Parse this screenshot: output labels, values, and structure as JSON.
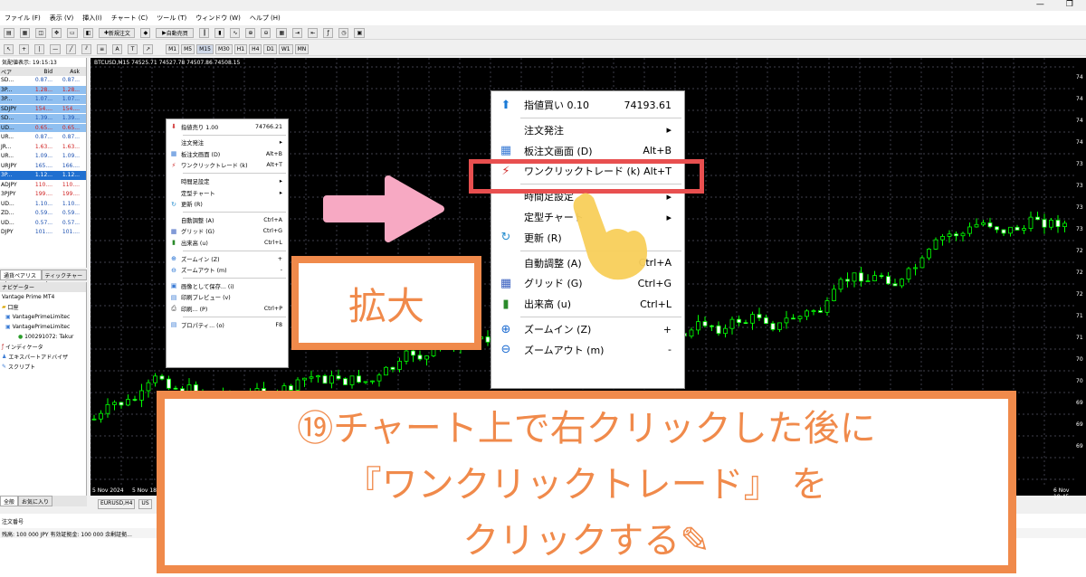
{
  "menubar": {
    "items": [
      "ファイル (F)",
      "表示 (V)",
      "挿入(I)",
      "チャート (C)",
      "ツール (T)",
      "ウィンドウ (W)",
      "ヘルプ (H)"
    ]
  },
  "window_controls": {
    "minimize": "—",
    "restore": "❐"
  },
  "toolbar": {
    "new_order": "新規注文",
    "auto_trade": "自動売買",
    "timeframes": [
      "M1",
      "M5",
      "M15",
      "M30",
      "H1",
      "H4",
      "D1",
      "W1",
      "MN"
    ]
  },
  "market_watch": {
    "title": "気配値表示: 19:15:13",
    "columns": [
      "ペア",
      "Bid",
      "Ask"
    ],
    "rows": [
      [
        "SD...",
        "0.87...",
        "0.87..."
      ],
      [
        "3P...",
        "1.28...",
        "1.28..."
      ],
      [
        "3P...",
        "1.07...",
        "1.07..."
      ],
      [
        "SDJPY",
        "154....",
        "154...."
      ],
      [
        "SD...",
        "1.39...",
        "1.39..."
      ],
      [
        "UD...",
        "0.65...",
        "0.65..."
      ],
      [
        "UR...",
        "0.87...",
        "0.87..."
      ],
      [
        "JR...",
        "1.63...",
        "1.63..."
      ],
      [
        "UR...",
        "1.09...",
        "1.09..."
      ],
      [
        "URJPY",
        "165....",
        "166...."
      ],
      [
        "3P...",
        "1.12...",
        "1.12..."
      ],
      [
        "ADJPY",
        "110....",
        "110...."
      ],
      [
        "3PJPY",
        "199....",
        "199...."
      ],
      [
        "UD...",
        "1.10...",
        "1.10..."
      ],
      [
        "ZD...",
        "0.59...",
        "0.59..."
      ],
      [
        "UD...",
        "0.57...",
        "0.57..."
      ],
      [
        "DJPY",
        "101....",
        "101...."
      ]
    ],
    "tabs": [
      "通貨ペアリスト",
      "ティックチャート"
    ]
  },
  "navigator": {
    "title": "ナビゲーター",
    "items": [
      "Vantage Prime MT4",
      "口座",
      "VantagePrimeLimitec",
      "VantagePrimeLimitec",
      "100291072: Takur",
      "インディケータ",
      "エキスパートアドバイザ",
      "スクリプト"
    ],
    "tabs": [
      "全般",
      "お気に入り"
    ]
  },
  "chart": {
    "title": "BTCUSD,M15  74525.71 74527.78 74507.86 74508.15",
    "x_labels": [
      "5 Nov 2024",
      "5 Nov 18:45",
      "6 Nov 18:45"
    ],
    "tabs": [
      "EURUSD,H4",
      "US"
    ],
    "y_labels": [
      "74",
      "74",
      "74",
      "74",
      "73",
      "73",
      "73",
      "73",
      "72",
      "72",
      "72",
      "71",
      "71",
      "70",
      "70",
      "69",
      "69",
      "69"
    ]
  },
  "terminal": {
    "order_label": "注文番号",
    "status": "残高: 100 000 JPY  有効証拠金: 100 000  余剰証拠..."
  },
  "small_menu": {
    "items": [
      {
        "label": "指値売り 1.00",
        "shortcut": "74766.21"
      },
      {
        "label": "注文発注",
        "shortcut": "▸"
      },
      {
        "label": "板注文画面 (D)",
        "shortcut": "Alt+B"
      },
      {
        "label": "ワンクリックトレード (k)",
        "shortcut": "Alt+T"
      },
      {
        "label": "時間足設定",
        "shortcut": "▸"
      },
      {
        "label": "定型チャート",
        "shortcut": "▸"
      },
      {
        "label": "更新 (R)",
        "shortcut": ""
      },
      {
        "label": "自動調整 (A)",
        "shortcut": "Ctrl+A"
      },
      {
        "label": "グリッド (G)",
        "shortcut": "Ctrl+G"
      },
      {
        "label": "出来高 (u)",
        "shortcut": "Ctrl+L"
      },
      {
        "label": "ズームイン (Z)",
        "shortcut": "+"
      },
      {
        "label": "ズームアウト (m)",
        "shortcut": "-"
      },
      {
        "label": "画像として保存... (i)",
        "shortcut": ""
      },
      {
        "label": "印刷プレビュー (v)",
        "shortcut": ""
      },
      {
        "label": "印刷... (P)",
        "shortcut": "Ctrl+P"
      },
      {
        "label": "プロパティ... (o)",
        "shortcut": "F8"
      }
    ]
  },
  "big_menu": {
    "items": [
      {
        "label": "指値買い 0.10",
        "shortcut": "74193.61"
      },
      {
        "label": "注文発注",
        "shortcut": "▸"
      },
      {
        "label": "板注文画面 (D)",
        "shortcut": "Alt+B"
      },
      {
        "label": "ワンクリックトレード (k)",
        "shortcut": "Alt+T"
      },
      {
        "label": "時間足設定",
        "shortcut": "▸"
      },
      {
        "label": "定型チャート",
        "shortcut": "▸"
      },
      {
        "label": "更新 (R)",
        "shortcut": ""
      },
      {
        "label": "自動調整 (A)",
        "shortcut": "Ctrl+A"
      },
      {
        "label": "グリッド (G)",
        "shortcut": "Ctrl+G"
      },
      {
        "label": "出来高 (u)",
        "shortcut": "Ctrl+L"
      },
      {
        "label": "ズームイン (Z)",
        "shortcut": "+"
      },
      {
        "label": "ズームアウト (m)",
        "shortcut": "-"
      }
    ]
  },
  "annotation": {
    "zoom_label": "拡大",
    "instruction": [
      "⑲チャート上で右クリックした後に",
      "『ワンクリックトレード』 を",
      "クリックする✎"
    ],
    "colors": {
      "accent": "#f08a4b",
      "highlight": "#e84f4f",
      "arrow": "#f7a9c3",
      "hand": "#f8cf5a"
    }
  }
}
